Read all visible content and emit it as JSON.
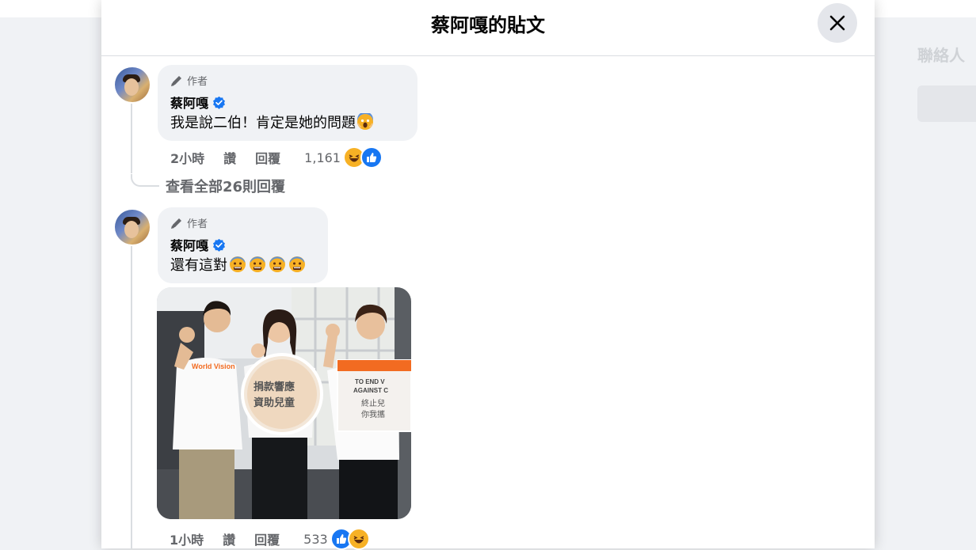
{
  "background": {
    "contacts_label": "聯絡人"
  },
  "modal": {
    "title": "蔡阿嘎的貼文"
  },
  "comments": [
    {
      "author_badge": "作者",
      "author": "蔡阿嘎",
      "text": "我是說二伯！肯定是她的問題",
      "emojis": [
        "screaming-face"
      ],
      "time": "2小時",
      "like_label": "讚",
      "reply_label": "回覆",
      "reaction_count": "1,161",
      "reactions": [
        "haha",
        "like"
      ]
    },
    {
      "author_badge": "作者",
      "author": "蔡阿嘎",
      "text": "還有這對",
      "emojis": [
        "anxious-face",
        "anxious-face",
        "anxious-face",
        "anxious-face"
      ],
      "time": "1小時",
      "like_label": "讚",
      "reply_label": "回覆",
      "reaction_count": "533",
      "reactions": [
        "like",
        "haha"
      ]
    }
  ],
  "view_replies": "查看全部26則回覆",
  "photo": {
    "banner_text_1": "World Vision",
    "sign_text_1": "捐款響應",
    "sign_text_2": "資助兒童",
    "board_text_1": "TO END V",
    "board_text_2": "AGAINST C",
    "board_text_3": "終止兒",
    "board_text_4": "你我攜"
  },
  "colors": {
    "verified": "#1877f2",
    "like": "#1877f2",
    "haha": "#f7b125",
    "muted": "#65676b",
    "bubble": "#f0f2f5"
  }
}
